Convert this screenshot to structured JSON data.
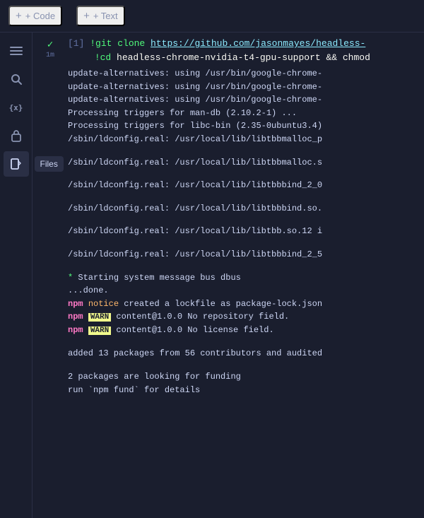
{
  "toolbar": {
    "code_btn": "+ Code",
    "text_btn": "+ Text"
  },
  "sidebar": {
    "icons": [
      {
        "name": "menu-icon",
        "label": "Menu",
        "unicode": "☰",
        "active": false
      },
      {
        "name": "search-icon",
        "label": "Search",
        "unicode": "🔍",
        "active": false
      },
      {
        "name": "braces-icon",
        "label": "Variables",
        "unicode": "{x}",
        "active": false
      },
      {
        "name": "key-icon",
        "label": "Secrets",
        "unicode": "🔑",
        "active": false
      },
      {
        "name": "files-icon",
        "label": "Files",
        "unicode": "📁",
        "active": true,
        "tooltip": "Files"
      }
    ]
  },
  "cell": {
    "number": "[1]",
    "time": "1m",
    "checkmark": "✓",
    "commands": [
      "!git clone https://github.com/jasonmayes/headless-",
      "!cd headless-chrome-nvidia-t4-gpu-support && chmod"
    ]
  },
  "output": {
    "lines": [
      {
        "type": "normal",
        "text": "update-alternatives: using /usr/bin/google-chrome-"
      },
      {
        "type": "normal",
        "text": "update-alternatives: using /usr/bin/google-chrome-"
      },
      {
        "type": "normal",
        "text": "update-alternatives: using /usr/bin/google-chrome-"
      },
      {
        "type": "normal",
        "text": "Processing triggers for man-db (2.10.2-1) ..."
      },
      {
        "type": "normal",
        "text": "Processing triggers for libc-bin (2.35-0ubuntu3.4)"
      },
      {
        "type": "normal",
        "text": "/sbin/ldconfig.real: /usr/local/lib/libtbbmalloc_p"
      },
      {
        "type": "empty"
      },
      {
        "type": "normal",
        "text": "/sbin/ldconfig.real: /usr/local/lib/libtbbmalloc.s"
      },
      {
        "type": "empty"
      },
      {
        "type": "normal",
        "text": "/sbin/ldconfig.real: /usr/local/lib/libtbbbind_2_0"
      },
      {
        "type": "empty"
      },
      {
        "type": "normal",
        "text": "/sbin/ldconfig.real: /usr/local/lib/libtbbbind.so."
      },
      {
        "type": "empty"
      },
      {
        "type": "normal",
        "text": "/sbin/ldconfig.real: /usr/local/lib/libtbb.so.12 i"
      },
      {
        "type": "empty"
      },
      {
        "type": "normal",
        "text": "/sbin/ldconfig.real: /usr/local/lib/libtbbbind_2_5"
      },
      {
        "type": "empty"
      },
      {
        "type": "asterisk",
        "text": " * Starting system message bus dbus"
      },
      {
        "type": "normal",
        "text": "   ...done."
      },
      {
        "type": "npm-notice",
        "npm": "npm",
        "label": "notice",
        "text": " created a lockfile as package-lock.json"
      },
      {
        "type": "npm-warn",
        "npm": "npm",
        "label": "WARN",
        "tag": "content@1.0.0",
        "text": " No repository field."
      },
      {
        "type": "npm-warn",
        "npm": "npm",
        "label": "WARN",
        "tag": "content@1.0.0",
        "text": " No license field."
      },
      {
        "type": "empty"
      },
      {
        "type": "normal",
        "text": "added 13 packages from 56 contributors and audited"
      },
      {
        "type": "empty"
      },
      {
        "type": "normal",
        "text": "2 packages are looking for funding"
      },
      {
        "type": "normal",
        "text": "  run `npm fund` for details"
      }
    ]
  }
}
